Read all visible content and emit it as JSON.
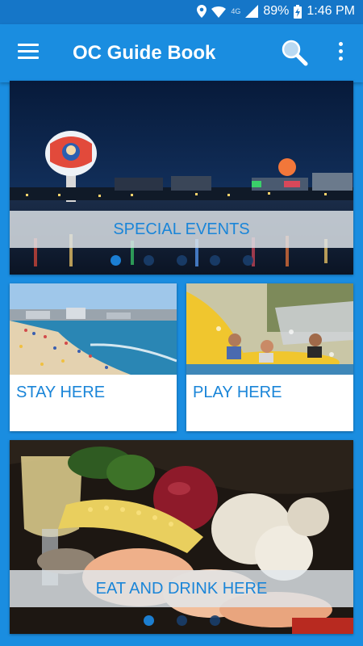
{
  "status": {
    "network": "4G",
    "battery": "89%",
    "time": "1:46 PM"
  },
  "appbar": {
    "title": "OC Guide Book",
    "menu_icon": "hamburger-menu-icon",
    "search_icon": "search-icon",
    "more_icon": "more-vert-icon"
  },
  "banner": {
    "label": "SPECIAL EVENTS",
    "active_dot": 0,
    "dot_count": 5
  },
  "tiles": [
    {
      "label": "STAY HERE"
    },
    {
      "label": "PLAY HERE"
    }
  ],
  "eat": {
    "label": "EAT AND DRINK HERE",
    "active_dot": 0,
    "dot_count": 3
  },
  "colors": {
    "appbar": "#1a8de0",
    "statusbar": "#1576c8",
    "accent_text": "#1a85d8"
  }
}
